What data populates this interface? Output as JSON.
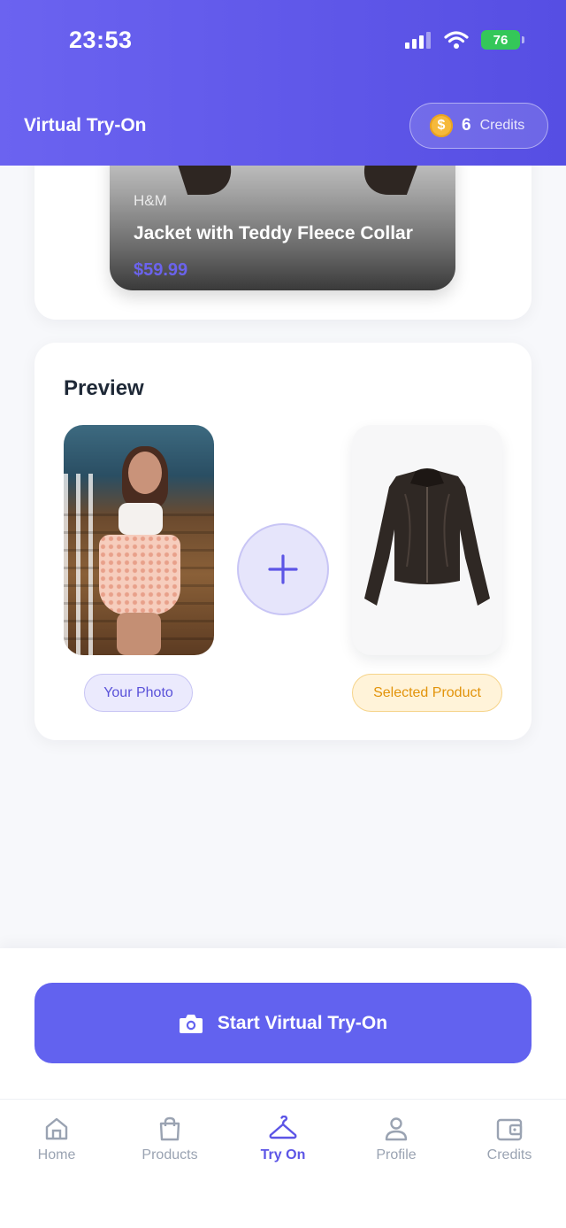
{
  "status_bar": {
    "time": "23:53",
    "battery": "76"
  },
  "header": {
    "title": "Virtual Try-On",
    "credits_count": "6",
    "credits_label": "Credits",
    "coin_symbol": "$"
  },
  "product": {
    "brand": "H&M",
    "name": "Jacket with Teddy Fleece Collar",
    "price": "$59.99"
  },
  "preview": {
    "title": "Preview",
    "your_photo_label": "Your Photo",
    "selected_product_label": "Selected Product"
  },
  "action": {
    "start_label": "Start Virtual Try-On"
  },
  "tabbar": {
    "items": [
      {
        "label": "Home",
        "icon": "home-icon"
      },
      {
        "label": "Products",
        "icon": "shopping-bag-icon"
      },
      {
        "label": "Try On",
        "icon": "hanger-icon"
      },
      {
        "label": "Profile",
        "icon": "user-icon"
      },
      {
        "label": "Credits",
        "icon": "wallet-icon"
      }
    ],
    "active": "Try On"
  },
  "colors": {
    "accent": "#6262ef",
    "header": "#564ee3",
    "price": "#6b63ec",
    "product_chip": "#e2930a",
    "inactive_tab": "#9aa3b2"
  }
}
